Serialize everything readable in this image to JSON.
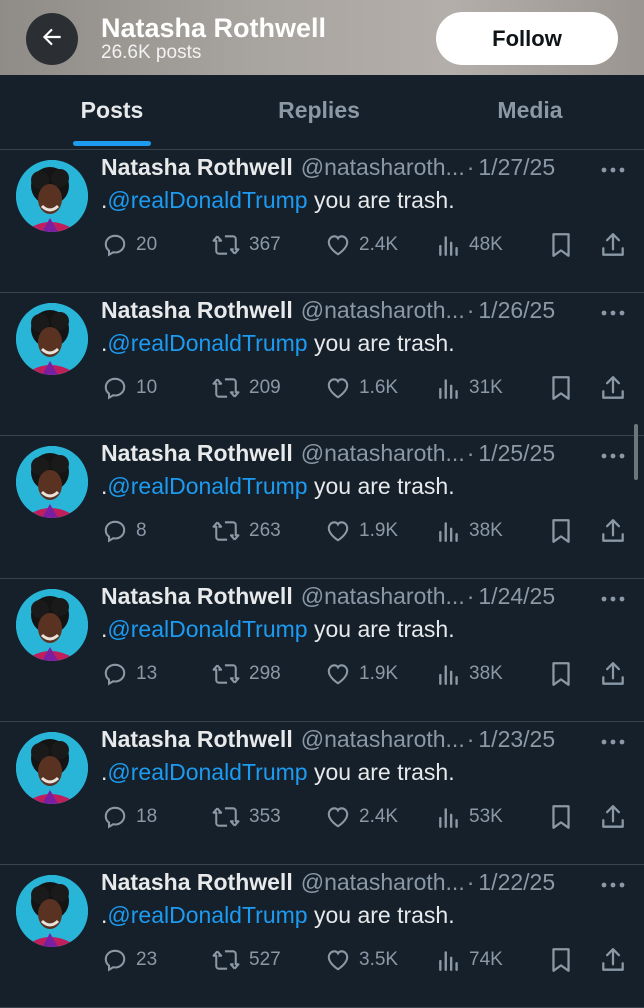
{
  "header": {
    "name": "Natasha Rothwell",
    "post_count": "26.6K posts",
    "follow_label": "Follow"
  },
  "tabs": [
    {
      "label": "Posts",
      "active": true
    },
    {
      "label": "Replies",
      "active": false
    },
    {
      "label": "Media",
      "active": false
    }
  ],
  "tweets": [
    {
      "name": "Natasha Rothwell",
      "handle": "@natasharoth...",
      "sep": "·",
      "date": "1/27/25",
      "prefix": ".",
      "mention": "@realDonaldTrump",
      "text": " you are trash.",
      "replies": "20",
      "reposts": "367",
      "likes": "2.4K",
      "views": "48K"
    },
    {
      "name": "Natasha Rothwell",
      "handle": "@natasharoth...",
      "sep": "·",
      "date": "1/26/25",
      "prefix": ".",
      "mention": "@realDonaldTrump",
      "text": " you are trash.",
      "replies": "10",
      "reposts": "209",
      "likes": "1.6K",
      "views": "31K"
    },
    {
      "name": "Natasha Rothwell",
      "handle": "@natasharoth...",
      "sep": "·",
      "date": "1/25/25",
      "prefix": ".",
      "mention": "@realDonaldTrump",
      "text": " you are trash.",
      "replies": "8",
      "reposts": "263",
      "likes": "1.9K",
      "views": "38K"
    },
    {
      "name": "Natasha Rothwell",
      "handle": "@natasharoth...",
      "sep": "·",
      "date": "1/24/25",
      "prefix": ".",
      "mention": "@realDonaldTrump",
      "text": " you are trash.",
      "replies": "13",
      "reposts": "298",
      "likes": "1.9K",
      "views": "38K"
    },
    {
      "name": "Natasha Rothwell",
      "handle": "@natasharoth...",
      "sep": "·",
      "date": "1/23/25",
      "prefix": ".",
      "mention": "@realDonaldTrump",
      "text": " you are trash.",
      "replies": "18",
      "reposts": "353",
      "likes": "2.4K",
      "views": "53K"
    },
    {
      "name": "Natasha Rothwell",
      "handle": "@natasharoth...",
      "sep": "·",
      "date": "1/22/25",
      "prefix": ".",
      "mention": "@realDonaldTrump",
      "text": " you are trash.",
      "replies": "23",
      "reposts": "527",
      "likes": "3.5K",
      "views": "74K"
    }
  ],
  "icons": {
    "back": "arrow-left-icon",
    "more": "more-horizontal-icon",
    "reply": "reply-icon",
    "repost": "repost-icon",
    "like": "heart-icon",
    "views": "views-icon",
    "bookmark": "bookmark-icon",
    "share": "share-icon"
  },
  "colors": {
    "background": "#15202b",
    "accent": "#1d9bf0",
    "text_primary": "#e7e9ea",
    "text_secondary": "#8b98a5",
    "divider": "#38444d"
  }
}
